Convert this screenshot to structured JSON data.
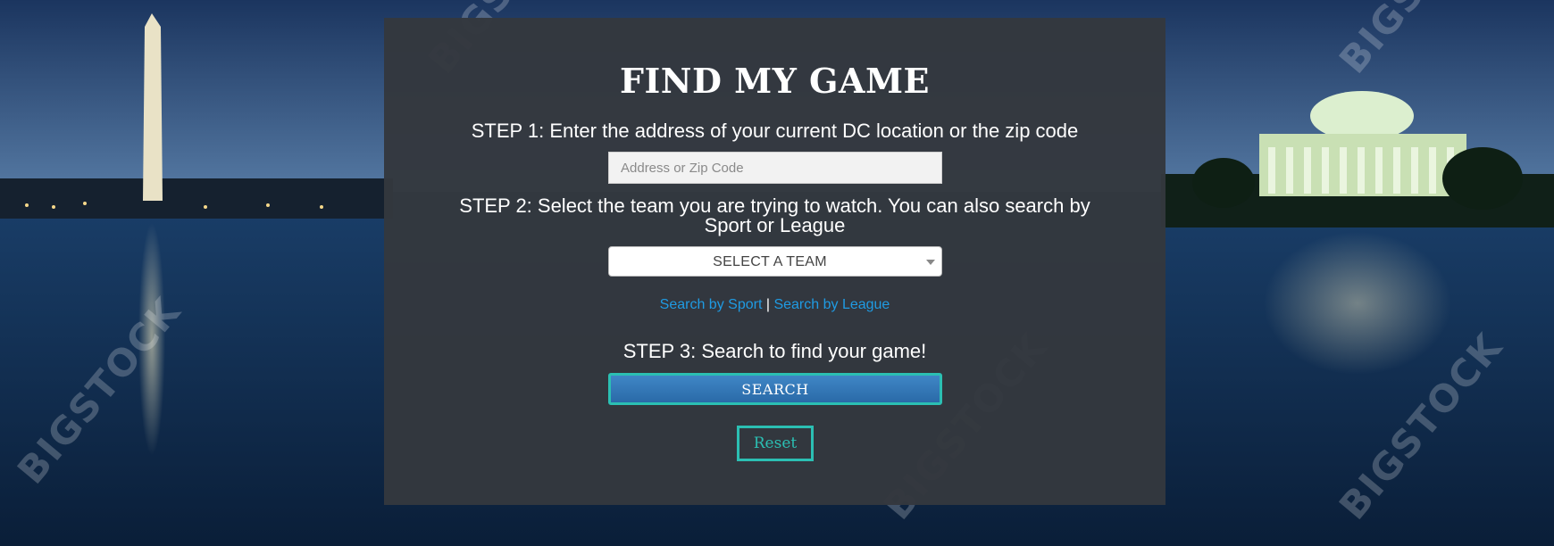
{
  "background": {
    "watermark_text": "BIGSTOCK"
  },
  "form": {
    "title": "FIND MY GAME",
    "step1_label": "STEP 1: Enter the address of your current DC location or the zip code",
    "address_placeholder": "Address or Zip Code",
    "address_value": "",
    "step2_label": "STEP 2: Select the team you are trying to watch. You can also search by Sport or League",
    "team_select_value": "SELECT A TEAM",
    "link_sport": "Search by Sport",
    "link_separator": "|",
    "link_league": "Search by League",
    "step3_label": "STEP 3: Search to find your game!",
    "search_button": "SEARCH",
    "reset_button": "Reset"
  },
  "colors": {
    "panel": "#34383e",
    "link": "#1f9be3",
    "accent_border": "#2bbfb3",
    "search_button": "#3579b8"
  },
  "icons": {
    "select_caret": "chevron-down-icon"
  }
}
